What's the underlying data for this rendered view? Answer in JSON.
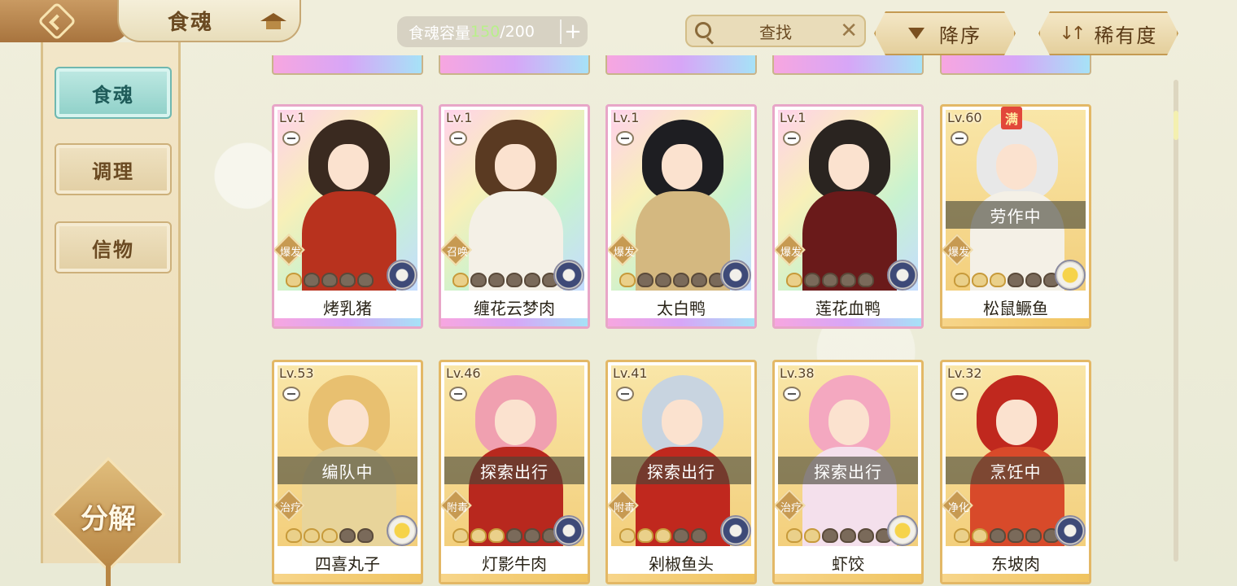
{
  "header": {
    "title": "食魂",
    "capacity_label": "食魂容量",
    "capacity_current": "150",
    "capacity_max": "/200",
    "capacity_add": "+",
    "search_label": "查找",
    "search_clear": "✕",
    "sort_order_label": "降序",
    "sort_order_arrow": "▼",
    "sort_key_label": "稀有度",
    "sort_key_arrows": "↓↑"
  },
  "sidebar": {
    "items": [
      {
        "label": "食魂",
        "active": true
      },
      {
        "label": "调理",
        "active": false
      },
      {
        "label": "信物",
        "active": false
      }
    ],
    "decompose_label": "分解"
  },
  "icons": {
    "back": "back-arrow-icon",
    "roof": "pavilion-icon",
    "search": "search-icon",
    "clear": "close-icon",
    "minus": "minus-icon",
    "element": "element-orb-icon"
  },
  "colors": {
    "accent_teal": "#8ed0c8",
    "gold_border": "#e3b866",
    "capacity_green": "#b8f08a",
    "full_badge": "#e2473a"
  },
  "cards": [
    {
      "level": "Lv.1",
      "name": "烤乳猪",
      "role": "爆发",
      "stars_on": 1,
      "stars_total": 5,
      "status": "",
      "full": "",
      "style": "rainbow",
      "element": "blue"
    },
    {
      "level": "Lv.1",
      "name": "缠花云梦肉",
      "role": "召唤",
      "stars_on": 1,
      "stars_total": 6,
      "status": "",
      "full": "",
      "style": "rainbow",
      "element": "blue"
    },
    {
      "level": "Lv.1",
      "name": "太白鸭",
      "role": "爆发",
      "stars_on": 1,
      "stars_total": 6,
      "status": "",
      "full": "",
      "style": "rainbow",
      "element": "blue"
    },
    {
      "level": "Lv.1",
      "name": "莲花血鸭",
      "role": "爆发",
      "stars_on": 1,
      "stars_total": 5,
      "status": "",
      "full": "",
      "style": "rainbow",
      "element": "blue"
    },
    {
      "level": "Lv.60",
      "name": "松鼠鳜鱼",
      "role": "爆发",
      "stars_on": 3,
      "stars_total": 6,
      "status": "劳作中",
      "full": "满",
      "style": "gold",
      "element": "gold"
    },
    {
      "level": "Lv.53",
      "name": "四喜丸子",
      "role": "治疗",
      "stars_on": 3,
      "stars_total": 5,
      "status": "编队中",
      "full": "",
      "style": "gold",
      "element": "gold"
    },
    {
      "level": "Lv.46",
      "name": "灯影牛肉",
      "role": "附毒",
      "stars_on": 3,
      "stars_total": 6,
      "status": "探索出行",
      "full": "",
      "style": "gold",
      "element": "blue"
    },
    {
      "level": "Lv.41",
      "name": "剁椒鱼头",
      "role": "附毒",
      "stars_on": 3,
      "stars_total": 5,
      "status": "探索出行",
      "full": "",
      "style": "gold",
      "element": "blue"
    },
    {
      "level": "Lv.38",
      "name": "虾饺",
      "role": "治疗",
      "stars_on": 2,
      "stars_total": 6,
      "status": "探索出行",
      "full": "",
      "style": "gold",
      "element": "gold"
    },
    {
      "level": "Lv.32",
      "name": "东坡肉",
      "role": "净化",
      "stars_on": 2,
      "stars_total": 6,
      "status": "烹饪中",
      "full": "",
      "style": "gold",
      "element": "blue"
    }
  ]
}
